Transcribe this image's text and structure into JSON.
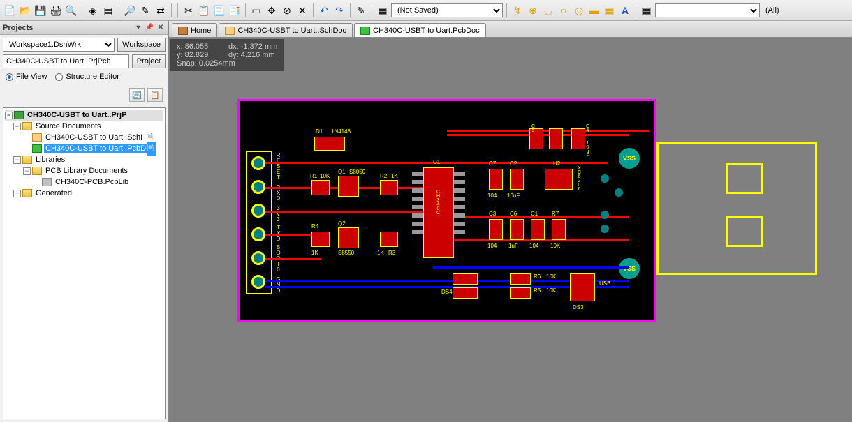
{
  "toolbar": {
    "save_state": "(Not Saved)",
    "filter_all": "(All)"
  },
  "panel": {
    "title": "Projects",
    "workspace_value": "Workspace1.DsnWrk",
    "workspace_btn": "Workspace",
    "project_value": "CH340C-USBT to Uart..PrjPcb",
    "project_btn": "Project",
    "view_file": "File View",
    "view_structure": "Structure Editor"
  },
  "tree": {
    "root": "CH340C-USBT to Uart..PrjP",
    "source_docs": "Source Documents",
    "sch_doc": "CH340C-USBT to Uart..SchI",
    "pcb_doc": "CH340C-USBT to Uart..PcbD",
    "libraries": "Libraries",
    "pcb_lib_docs": "PCB Library Documents",
    "pcb_lib_file": "CH340C-PCB.PcbLib",
    "generated": "Generated"
  },
  "tabs": {
    "home": "Home",
    "sch": "CH340C-USBT to Uart..SchDoc",
    "pcb": "CH340C-USBT to Uart.PcbDoc"
  },
  "coords": {
    "x": "x: 86.055",
    "dx": "dx: -1.372 mm",
    "y": "y: 82.829",
    "dy": "dy:  4.216 mm",
    "snap": "Snap: 0.0254mm"
  },
  "pcb": {
    "d1": "D1",
    "d1_type": "1N4148",
    "r1": "R1",
    "r1_val": "10K",
    "q1": "Q1",
    "q1_type": "S8050",
    "r2": "R2",
    "r2_val": "1K",
    "r4": "R4",
    "q2": "Q2",
    "r3": "R3",
    "r3_val": "1K",
    "q2_type": "S8550",
    "r4_val": "1K",
    "u1": "U1",
    "u1_type": "CH340C",
    "c7": "C7",
    "c2": "C2",
    "c5": "C5",
    "c4": "C4",
    "c3": "C3",
    "c6": "C6",
    "c1": "C1",
    "r7": "R7",
    "u2": "U2",
    "u2_type": "XC6206",
    "cap_104": "104",
    "cap_10uf": "10uF",
    "cap_1uf": "1uF",
    "r_10k": "10K",
    "r6": "R6",
    "r5": "R5",
    "ds3": "DS3",
    "ds4": "DS4",
    "usb": "USB",
    "vss": "VSS",
    "hdr_reset": "RESET",
    "hdr_rxd": "RXD",
    "hdr_3v3": "3V3",
    "hdr_txd": "TXD",
    "hdr_boot0": "BOOT0",
    "hdr_gnd": "GND"
  }
}
